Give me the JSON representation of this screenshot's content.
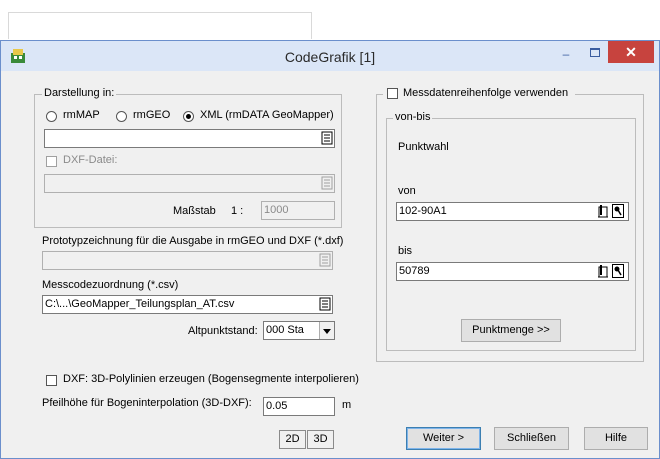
{
  "window": {
    "title": "CodeGrafik [1]"
  },
  "darstellung": {
    "legend": "Darstellung in:",
    "options": [
      {
        "label": "rmMAP",
        "selected": false
      },
      {
        "label": "rmGEO",
        "selected": false
      },
      {
        "label": "XML (rmDATA GeoMapper)",
        "selected": true
      }
    ],
    "path_value": "",
    "dxf_checkbox_label": "DXF-Datei:",
    "dxf_path_value": "",
    "scale_label": "Maßstab",
    "scale_prefix": "1 :",
    "scale_value": "1000"
  },
  "prototype": {
    "label": "Prototypzeichnung für die Ausgabe in rmGEO und DXF (*.dxf)",
    "value": ""
  },
  "messcode": {
    "label": "Messcodezuordnung (*.csv)",
    "value": "C:\\...\\GeoMapper_Teilungsplan_AT.csv"
  },
  "altpunkt": {
    "label": "Altpunktstand:",
    "value": "000   Sta"
  },
  "dxf3d": {
    "label": "DXF: 3D-Polylinien erzeugen (Bogensegmente interpolieren)",
    "checked": false
  },
  "pfeil": {
    "label": "Pfeilhöhe für Bogeninterpolation (3D-DXF):",
    "value": "0.05",
    "unit": "m"
  },
  "view_buttons": {
    "two_d": "2D",
    "three_d": "3D"
  },
  "messdaten": {
    "checkbox_label": "Messdatenreihenfolge verwenden",
    "checked": false,
    "vonbis_legend": "von-bis",
    "punktwahl_label": "Punktwahl",
    "von_label": "von",
    "von_value": "102-90A1",
    "bis_label": "bis",
    "bis_value": "50789",
    "punktmenge_button": "Punktmenge >>"
  },
  "footer": {
    "weiter": "Weiter >",
    "schliessen": "Schließen",
    "hilfe": "Hilfe"
  },
  "window_controls": {
    "minimize": "–",
    "close": "✕"
  },
  "icons": [
    "app-icon",
    "file-browse-icon",
    "pick-point-icon",
    "pointer-icon",
    "chevron-down-icon"
  ]
}
